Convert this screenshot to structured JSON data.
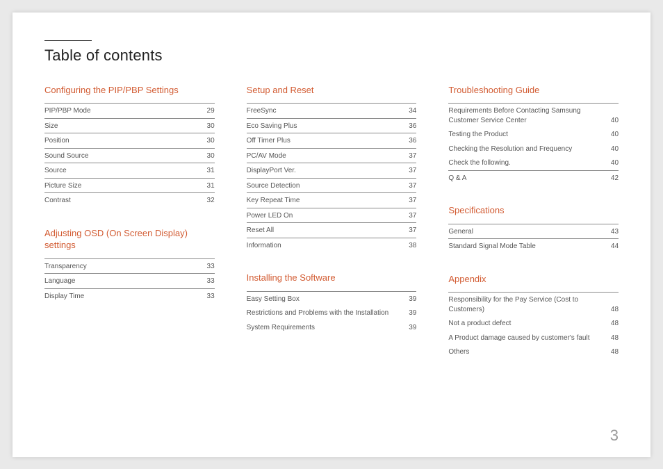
{
  "title": "Table of contents",
  "page_number": "3",
  "columns": [
    {
      "sections": [
        {
          "heading": "Configuring the PIP/PBP Settings",
          "entries": [
            {
              "label": "PIP/PBP Mode",
              "page": "29",
              "ruled": true
            },
            {
              "label": "Size",
              "page": "30",
              "ruled": true
            },
            {
              "label": "Position",
              "page": "30",
              "ruled": true
            },
            {
              "label": "Sound Source",
              "page": "30",
              "ruled": true
            },
            {
              "label": "Source",
              "page": "31",
              "ruled": true
            },
            {
              "label": "Picture Size",
              "page": "31",
              "ruled": true
            },
            {
              "label": "Contrast",
              "page": "32",
              "ruled": true
            }
          ]
        },
        {
          "heading": "Adjusting OSD (On Screen Display) settings",
          "entries": [
            {
              "label": "Transparency",
              "page": "33",
              "ruled": true
            },
            {
              "label": "Language",
              "page": "33",
              "ruled": true
            },
            {
              "label": "Display Time",
              "page": "33",
              "ruled": true
            }
          ]
        }
      ]
    },
    {
      "sections": [
        {
          "heading": "Setup and Reset",
          "entries": [
            {
              "label": "FreeSync",
              "page": "34",
              "ruled": true
            },
            {
              "label": "Eco Saving Plus",
              "page": "36",
              "ruled": true
            },
            {
              "label": "Off Timer Plus",
              "page": "36",
              "ruled": true
            },
            {
              "label": "PC/AV Mode",
              "page": "37",
              "ruled": true
            },
            {
              "label": "DisplayPort Ver.",
              "page": "37",
              "ruled": true
            },
            {
              "label": "Source Detection",
              "page": "37",
              "ruled": true
            },
            {
              "label": "Key Repeat Time",
              "page": "37",
              "ruled": true
            },
            {
              "label": "Power LED On",
              "page": "37",
              "ruled": true
            },
            {
              "label": "Reset All",
              "page": "37",
              "ruled": true
            },
            {
              "label": "Information",
              "page": "38",
              "ruled": true
            }
          ]
        },
        {
          "heading": "Installing the Software",
          "entries": [
            {
              "label": "Easy Setting Box",
              "page": "39",
              "ruled": true
            },
            {
              "label": "Restrictions and Problems with the Installation",
              "page": "39",
              "ruled": false
            },
            {
              "label": "System Requirements",
              "page": "39",
              "ruled": false
            }
          ]
        }
      ]
    },
    {
      "sections": [
        {
          "heading": "Troubleshooting Guide",
          "entries": [
            {
              "label": "Requirements Before Contacting Samsung Customer Service Center",
              "page": "40",
              "ruled": true
            },
            {
              "label": "Testing the Product",
              "page": "40",
              "ruled": false
            },
            {
              "label": "Checking the Resolution and Frequency",
              "page": "40",
              "ruled": false
            },
            {
              "label": "Check the following.",
              "page": "40",
              "ruled": false
            },
            {
              "label": "Q & A",
              "page": "42",
              "ruled": true
            }
          ]
        },
        {
          "heading": "Specifications",
          "entries": [
            {
              "label": "General",
              "page": "43",
              "ruled": true
            },
            {
              "label": "Standard Signal Mode Table",
              "page": "44",
              "ruled": true
            }
          ]
        },
        {
          "heading": "Appendix",
          "entries": [
            {
              "label": "Responsibility for the Pay Service (Cost to Customers)",
              "page": "48",
              "ruled": true
            },
            {
              "label": "Not a product defect",
              "page": "48",
              "ruled": false
            },
            {
              "label": "A Product damage caused by customer's fault",
              "page": "48",
              "ruled": false
            },
            {
              "label": "Others",
              "page": "48",
              "ruled": false
            }
          ]
        }
      ]
    }
  ]
}
